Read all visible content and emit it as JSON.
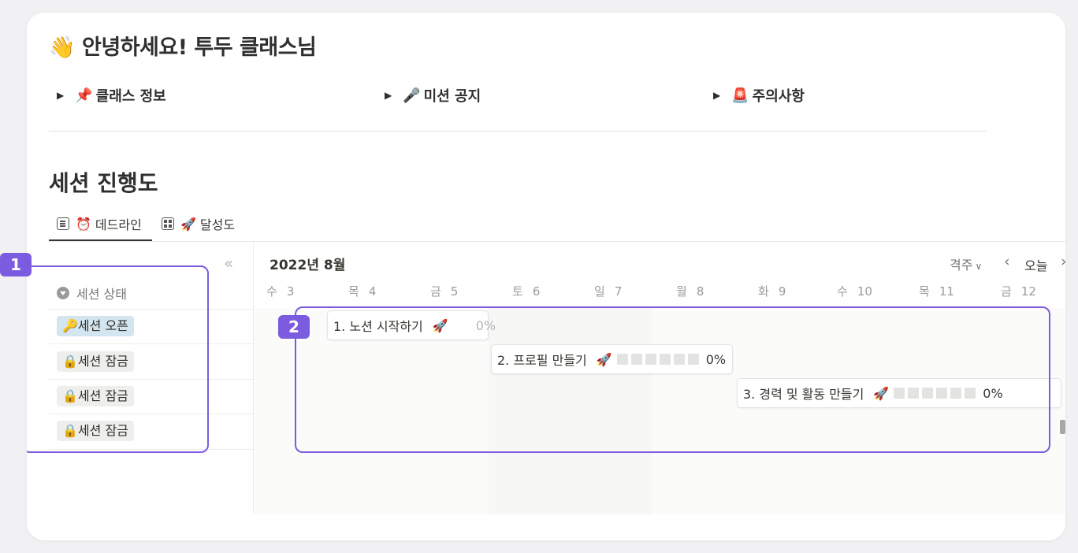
{
  "page": {
    "greeting": "👋 안녕하세요! 투두 클래스님",
    "toggles": [
      {
        "emoji": "📌",
        "label": "클래스 정보"
      },
      {
        "emoji": "🎤",
        "label": "미션 공지"
      },
      {
        "emoji": "🚨",
        "label": "주의사항"
      }
    ],
    "section_title": "세션 진행도"
  },
  "tabs": [
    {
      "emoji": "⏰",
      "label": "데드라인",
      "icon": "list-icon",
      "active": true
    },
    {
      "emoji": "🚀",
      "label": "달성도",
      "icon": "grid-icon",
      "active": false
    }
  ],
  "sidebar": {
    "collapse_icon": "«",
    "header": "세션 상태",
    "rows": [
      {
        "emoji": "🔑",
        "label": "세션 오픈",
        "style": "open"
      },
      {
        "emoji": "🔒",
        "label": "세션 잠금",
        "style": "lock"
      },
      {
        "emoji": "🔒",
        "label": "세션 잠금",
        "style": "lock"
      },
      {
        "emoji": "🔒",
        "label": "세션 잠금",
        "style": "lock"
      }
    ]
  },
  "timeline": {
    "month": "2022년 8월",
    "range_label": "격주",
    "today_label": "오늘",
    "prev_icon": "‹",
    "next_icon": "›",
    "days": [
      {
        "dow": "수",
        "num": "3"
      },
      {
        "dow": "목",
        "num": "4"
      },
      {
        "dow": "금",
        "num": "5"
      },
      {
        "dow": "토",
        "num": "6"
      },
      {
        "dow": "일",
        "num": "7"
      },
      {
        "dow": "월",
        "num": "8"
      },
      {
        "dow": "화",
        "num": "9"
      },
      {
        "dow": "수",
        "num": "10"
      },
      {
        "dow": "목",
        "num": "11"
      },
      {
        "dow": "금",
        "num": "12"
      }
    ],
    "tasks": [
      {
        "title": "1. 노션 시작하기",
        "emoji": "🚀",
        "progress": "0%"
      },
      {
        "title": "2. 프로필 만들기",
        "emoji": "🚀",
        "progress": "0%"
      },
      {
        "title": "3. 경력 및 활동 만들기",
        "emoji": "🚀",
        "progress": "0%"
      }
    ]
  },
  "annotations": {
    "badge1": "1",
    "badge2": "2"
  },
  "colors": {
    "accent": "#7b5ce0",
    "open_tag": "#d3e5ef",
    "lock_tag": "#eeeeed"
  }
}
